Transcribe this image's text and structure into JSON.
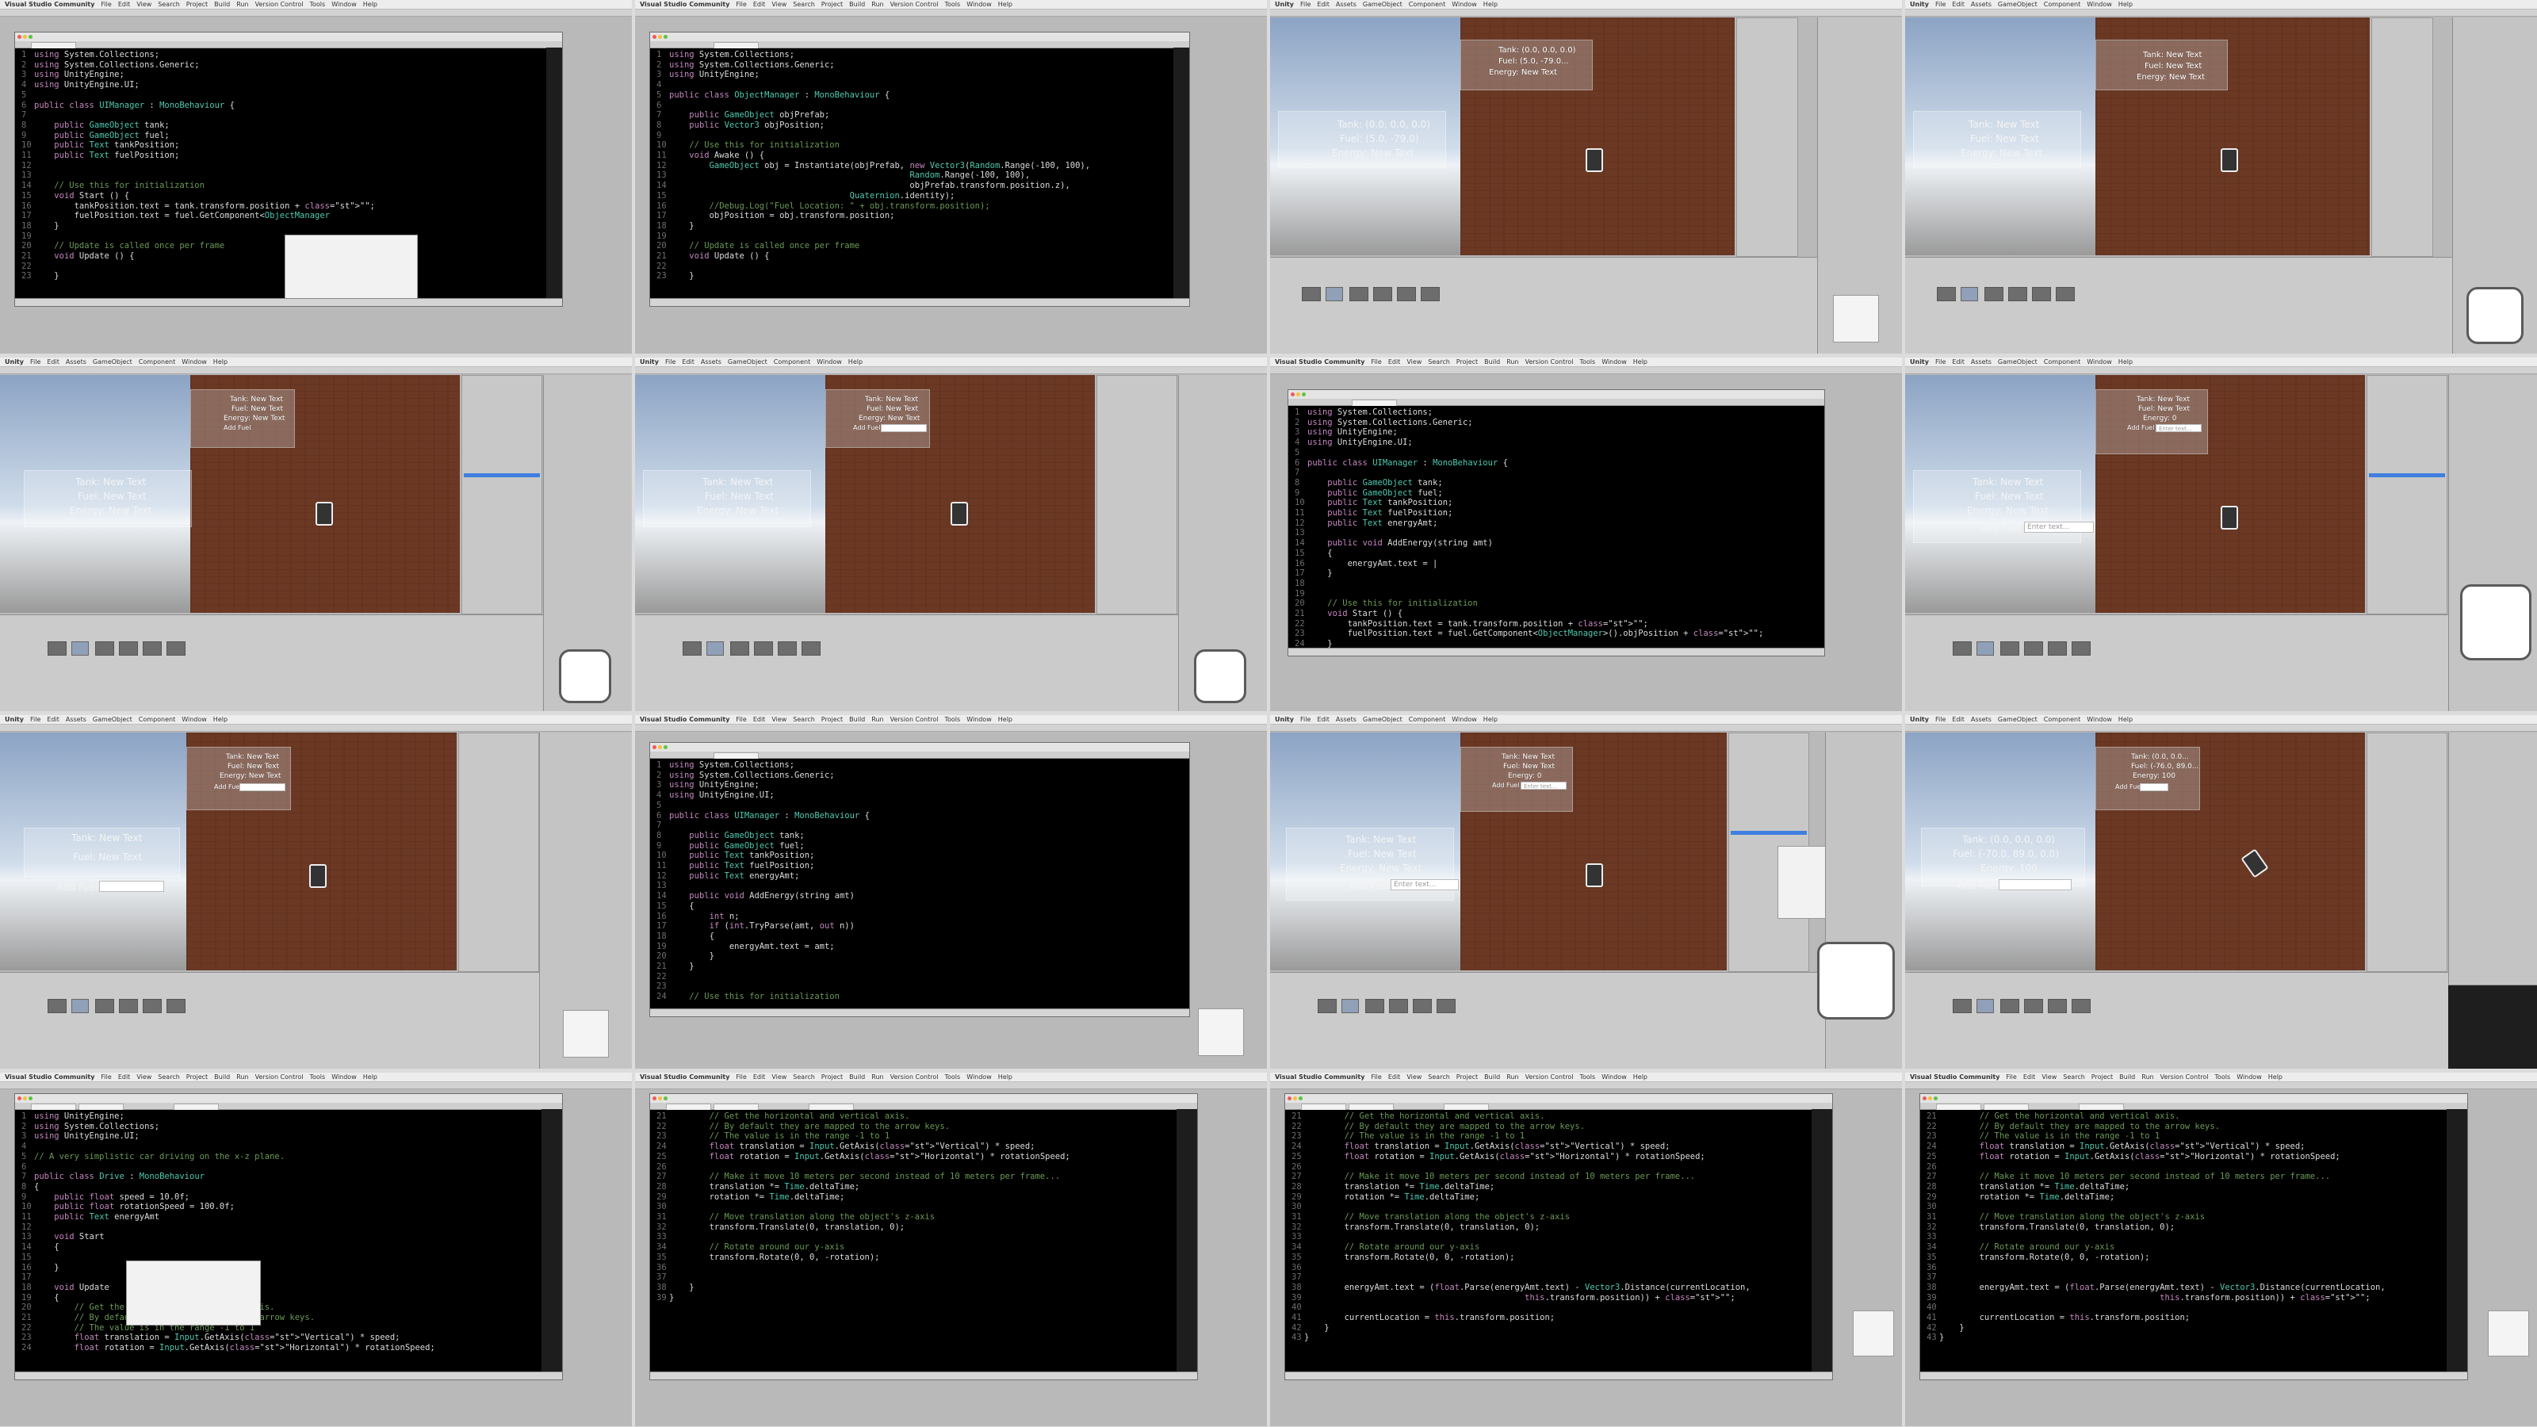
{
  "menus": {
    "vs": {
      "app": "Visual Studio Community",
      "items": [
        "File",
        "Edit",
        "View",
        "Search",
        "Project",
        "Build",
        "Run",
        "Version Control",
        "Tools",
        "Window",
        "Help"
      ]
    },
    "unity": {
      "app": "Unity",
      "items": [
        "File",
        "Edit",
        "Assets",
        "GameObject",
        "Component",
        "Window",
        "Help"
      ]
    }
  },
  "tiles": {
    "t1": {
      "lines": [
        [
          "1",
          "using System.Collections;"
        ],
        [
          "2",
          "using System.Collections.Generic;"
        ],
        [
          "3",
          "using UnityEngine;"
        ],
        [
          "4",
          "using UnityEngine.UI;"
        ],
        [
          "5",
          ""
        ],
        [
          "6",
          "public class UIManager : MonoBehaviour {"
        ],
        [
          "7",
          ""
        ],
        [
          "8",
          "    public GameObject tank;"
        ],
        [
          "9",
          "    public GameObject fuel;"
        ],
        [
          "10",
          "    public Text tankPosition;"
        ],
        [
          "11",
          "    public Text fuelPosition;"
        ],
        [
          "12",
          ""
        ],
        [
          "13",
          ""
        ],
        [
          "14",
          "    // Use this for initialization"
        ],
        [
          "15",
          "    void Start () {"
        ],
        [
          "16",
          "        tankPosition.text = tank.transform.position + \"\";"
        ],
        [
          "17",
          "        fuelPosition.text = fuel.GetComponent<ObjectManager"
        ],
        [
          "18",
          "    }"
        ],
        [
          "19",
          ""
        ],
        [
          "20",
          "    // Update is called once per frame"
        ],
        [
          "21",
          "    void Update () {"
        ],
        [
          "22",
          ""
        ],
        [
          "23",
          "    }"
        ]
      ]
    },
    "t2": {
      "lines": [
        [
          "1",
          "using System.Collections;"
        ],
        [
          "2",
          "using System.Collections.Generic;"
        ],
        [
          "3",
          "using UnityEngine;"
        ],
        [
          "4",
          ""
        ],
        [
          "5",
          "public class ObjectManager : MonoBehaviour {"
        ],
        [
          "6",
          ""
        ],
        [
          "7",
          "    public GameObject objPrefab;"
        ],
        [
          "8",
          "    public Vector3 objPosition;"
        ],
        [
          "9",
          ""
        ],
        [
          "10",
          "    // Use this for initialization"
        ],
        [
          "11",
          "    void Awake () {"
        ],
        [
          "12",
          "        GameObject obj = Instantiate(objPrefab, new Vector3(Random.Range(-100, 100),"
        ],
        [
          "13",
          "                                                Random.Range(-100, 100),"
        ],
        [
          "14",
          "                                                objPrefab.transform.position.z),"
        ],
        [
          "15",
          "                                    Quaternion.identity);"
        ],
        [
          "16",
          "        //Debug.Log(\"Fuel Location: \" + obj.transform.position);"
        ],
        [
          "17",
          "        objPosition = obj.transform.position;"
        ],
        [
          "18",
          "    }"
        ],
        [
          "19",
          ""
        ],
        [
          "20",
          "    // Update is called once per frame"
        ],
        [
          "21",
          "    void Update () {"
        ],
        [
          "22",
          ""
        ],
        [
          "23",
          "    }"
        ]
      ]
    },
    "t3": {
      "tank": "Tank: (0.0, 0.0, 0.0)",
      "fuel": "Fuel: (5.0, -79.0...",
      "energy": "Energy: New Text",
      "tank_l": "Tank: (0.0, 0.0, 0.0)",
      "fuel_l": "Fuel: (5.0, -79.0)",
      "energy_l": "Energy: New Text"
    },
    "t4": {
      "tank": "Tank: New Text",
      "fuel": "Fuel: New Text",
      "energy": "Energy: New Text",
      "tank_l": "Tank: New Text",
      "fuel_l": "Fuel: New Text",
      "energy_l": "Energy: New Text"
    },
    "t5": {
      "tank": "Tank: New Text",
      "fuel": "Fuel: New Text",
      "energy": "Energy: New Text",
      "add": "Add Fuel",
      "tank_l": "Tank: New Text",
      "fuel_l": "Fuel: New Text",
      "energy_l": "Energy: New Text"
    },
    "t6": {
      "tank": "Tank: New Text",
      "fuel": "Fuel: New Text",
      "energy": "Energy: New Text",
      "add": "Add Fuel",
      "tank_l": "Tank: New Text",
      "fuel_l": "Fuel: New Text",
      "energy_l": "Energy: New Text"
    },
    "t7": {
      "lines": [
        [
          "1",
          "using System.Collections;"
        ],
        [
          "2",
          "using System.Collections.Generic;"
        ],
        [
          "3",
          "using UnityEngine;"
        ],
        [
          "4",
          "using UnityEngine.UI;"
        ],
        [
          "5",
          ""
        ],
        [
          "6",
          "public class UIManager : MonoBehaviour {"
        ],
        [
          "7",
          ""
        ],
        [
          "8",
          "    public GameObject tank;"
        ],
        [
          "9",
          "    public GameObject fuel;"
        ],
        [
          "10",
          "    public Text tankPosition;"
        ],
        [
          "11",
          "    public Text fuelPosition;"
        ],
        [
          "12",
          "    public Text energyAmt;"
        ],
        [
          "13",
          ""
        ],
        [
          "14",
          "    public void AddEnergy(string amt)"
        ],
        [
          "15",
          "    {"
        ],
        [
          "16",
          "        energyAmt.text = |"
        ],
        [
          "17",
          "    }"
        ],
        [
          "18",
          ""
        ],
        [
          "19",
          ""
        ],
        [
          "20",
          "    // Use this for initialization"
        ],
        [
          "21",
          "    void Start () {"
        ],
        [
          "22",
          "        tankPosition.text = tank.transform.position + \"\";"
        ],
        [
          "23",
          "        fuelPosition.text = fuel.GetComponent<ObjectManager>().objPosition + \"\";"
        ],
        [
          "24",
          "    }"
        ]
      ]
    },
    "t8": {
      "tank": "Tank: New Text",
      "fuel": "Fuel: New Text",
      "energy": "Energy: 0",
      "add": "Add Fuel",
      "placeholder": "Enter text...",
      "tank_l": "Tank: New Text",
      "fuel_l": "Fuel: New Text",
      "energy_l": "Energy: New Text",
      "add_l": "Add Fuel",
      "placeholder_l": "Enter text..."
    },
    "t9": {
      "tank": "Tank: New Text",
      "fuel": "Fuel: New Text",
      "energy": "Energy: New Text",
      "add": "Add Fuel",
      "tank_l": "Tank: New Text",
      "fuel_l": "Fuel: New Text",
      "add_l": "Add Fuel"
    },
    "t10": {
      "lines": [
        [
          "1",
          "using System.Collections;"
        ],
        [
          "2",
          "using System.Collections.Generic;"
        ],
        [
          "3",
          "using UnityEngine;"
        ],
        [
          "4",
          "using UnityEngine.UI;"
        ],
        [
          "5",
          ""
        ],
        [
          "6",
          "public class UIManager : MonoBehaviour {"
        ],
        [
          "7",
          ""
        ],
        [
          "8",
          "    public GameObject tank;"
        ],
        [
          "9",
          "    public GameObject fuel;"
        ],
        [
          "10",
          "    public Text tankPosition;"
        ],
        [
          "11",
          "    public Text fuelPosition;"
        ],
        [
          "12",
          "    public Text energyAmt;"
        ],
        [
          "13",
          ""
        ],
        [
          "14",
          "    public void AddEnergy(string amt)"
        ],
        [
          "15",
          "    {"
        ],
        [
          "16",
          "        int n;"
        ],
        [
          "17",
          "        if (int.TryParse(amt, out n))"
        ],
        [
          "18",
          "        {"
        ],
        [
          "19",
          "            energyAmt.text = amt;"
        ],
        [
          "20",
          "        }"
        ],
        [
          "21",
          "    }"
        ],
        [
          "22",
          ""
        ],
        [
          "23",
          ""
        ],
        [
          "24",
          "    // Use this for initialization"
        ]
      ]
    },
    "t11": {
      "tank": "Tank: New Text",
      "fuel": "Fuel: New Text",
      "energy": "Energy: 0",
      "add": "Add Fuel",
      "placeholder": "Enter text...",
      "tank_l": "Tank: New Text",
      "fuel_l": "Fuel: New Text",
      "energy_l": "Energy: New Text",
      "add_l": "Add Fuel",
      "placeholder_l": "Enter text..."
    },
    "t12": {
      "tank": "Tank: (0.0, 0.0...",
      "fuel": "Fuel: (-76.0, 89.0...",
      "energy": "Energy: 100",
      "add": "Add Fuel",
      "tank_l": "Tank: (0.0, 0.0, 0.0)",
      "fuel_l": "Fuel: (-70.0, 89.0, 0.0)",
      "energy_l": "Energy: 100",
      "add_l": "Add Fuel"
    },
    "t13": {
      "lines": [
        [
          "1",
          "using UnityEngine;"
        ],
        [
          "2",
          "using System.Collections;"
        ],
        [
          "3",
          "using UnityEngine.UI;"
        ],
        [
          "4",
          ""
        ],
        [
          "5",
          "// A very simplistic car driving on the x-z plane."
        ],
        [
          "6",
          ""
        ],
        [
          "7",
          "public class Drive : MonoBehaviour"
        ],
        [
          "8",
          "{"
        ],
        [
          "9",
          "    public float speed = 10.0f;"
        ],
        [
          "10",
          "    public float rotationSpeed = 100.0f;"
        ],
        [
          "11",
          "    public Text energyAmt"
        ],
        [
          "12",
          ""
        ],
        [
          "13",
          "    void Start"
        ],
        [
          "14",
          "    {"
        ],
        [
          "15",
          ""
        ],
        [
          "16",
          "    }"
        ],
        [
          "17",
          ""
        ],
        [
          "18",
          "    void Update"
        ],
        [
          "19",
          "    {"
        ],
        [
          "20",
          "        // Get the horizontal and vertical axis."
        ],
        [
          "21",
          "        // By default they are mapped to the arrow keys."
        ],
        [
          "22",
          "        // The value is in the range -1 to 1"
        ],
        [
          "23",
          "        float translation = Input.GetAxis(\"Vertical\") * speed;"
        ],
        [
          "24",
          "        float rotation = Input.GetAxis(\"Horizontal\") * rotationSpeed;"
        ]
      ]
    },
    "t14": {
      "lines": [
        [
          "21",
          "        // Get the horizontal and vertical axis."
        ],
        [
          "22",
          "        // By default they are mapped to the arrow keys."
        ],
        [
          "23",
          "        // The value is in the range -1 to 1"
        ],
        [
          "24",
          "        float translation = Input.GetAxis(\"Vertical\") * speed;"
        ],
        [
          "25",
          "        float rotation = Input.GetAxis(\"Horizontal\") * rotationSpeed;"
        ],
        [
          "26",
          ""
        ],
        [
          "27",
          "        // Make it move 10 meters per second instead of 10 meters per frame..."
        ],
        [
          "28",
          "        translation *= Time.deltaTime;"
        ],
        [
          "29",
          "        rotation *= Time.deltaTime;"
        ],
        [
          "30",
          ""
        ],
        [
          "31",
          "        // Move translation along the object's z-axis"
        ],
        [
          "32",
          "        transform.Translate(0, translation, 0);"
        ],
        [
          "33",
          ""
        ],
        [
          "34",
          "        // Rotate around our y-axis"
        ],
        [
          "35",
          "        transform.Rotate(0, 0, -rotation);"
        ],
        [
          "36",
          ""
        ],
        [
          "37",
          ""
        ],
        [
          "38",
          "    }"
        ],
        [
          "39",
          "}"
        ]
      ]
    },
    "t15": {
      "lines": [
        [
          "21",
          "        // Get the horizontal and vertical axis."
        ],
        [
          "22",
          "        // By default they are mapped to the arrow keys."
        ],
        [
          "23",
          "        // The value is in the range -1 to 1"
        ],
        [
          "24",
          "        float translation = Input.GetAxis(\"Vertical\") * speed;"
        ],
        [
          "25",
          "        float rotation = Input.GetAxis(\"Horizontal\") * rotationSpeed;"
        ],
        [
          "26",
          ""
        ],
        [
          "27",
          "        // Make it move 10 meters per second instead of 10 meters per frame..."
        ],
        [
          "28",
          "        translation *= Time.deltaTime;"
        ],
        [
          "29",
          "        rotation *= Time.deltaTime;"
        ],
        [
          "30",
          ""
        ],
        [
          "31",
          "        // Move translation along the object's z-axis"
        ],
        [
          "32",
          "        transform.Translate(0, translation, 0);"
        ],
        [
          "33",
          ""
        ],
        [
          "34",
          "        // Rotate around our y-axis"
        ],
        [
          "35",
          "        transform.Rotate(0, 0, -rotation);"
        ],
        [
          "36",
          ""
        ],
        [
          "37",
          ""
        ],
        [
          "38",
          "        energyAmt.text = (float.Parse(energyAmt.text) - Vector3.Distance(currentLocation,"
        ],
        [
          "39",
          "                                            this.transform.position)) + \"\";"
        ],
        [
          "40",
          ""
        ],
        [
          "41",
          "        currentLocation = this.transform.position;"
        ],
        [
          "42",
          "    }"
        ],
        [
          "43",
          "}"
        ]
      ]
    },
    "t16": {
      "lines": [
        [
          "21",
          "        // Get the horizontal and vertical axis."
        ],
        [
          "22",
          "        // By default they are mapped to the arrow keys."
        ],
        [
          "23",
          "        // The value is in the range -1 to 1"
        ],
        [
          "24",
          "        float translation = Input.GetAxis(\"Vertical\") * speed;"
        ],
        [
          "25",
          "        float rotation = Input.GetAxis(\"Horizontal\") * rotationSpeed;"
        ],
        [
          "26",
          ""
        ],
        [
          "27",
          "        // Make it move 10 meters per second instead of 10 meters per frame..."
        ],
        [
          "28",
          "        translation *= Time.deltaTime;"
        ],
        [
          "29",
          "        rotation *= Time.deltaTime;"
        ],
        [
          "30",
          ""
        ],
        [
          "31",
          "        // Move translation along the object's z-axis"
        ],
        [
          "32",
          "        transform.Translate(0, translation, 0);"
        ],
        [
          "33",
          ""
        ],
        [
          "34",
          "        // Rotate around our y-axis"
        ],
        [
          "35",
          "        transform.Rotate(0, 0, -rotation);"
        ],
        [
          "36",
          ""
        ],
        [
          "37",
          ""
        ],
        [
          "38",
          "        energyAmt.text = (float.Parse(energyAmt.text) - Vector3.Distance(currentLocation,"
        ],
        [
          "39",
          "                                            this.transform.position)) + \"\";"
        ],
        [
          "40",
          ""
        ],
        [
          "41",
          "        currentLocation = this.transform.position;"
        ],
        [
          "42",
          "    }"
        ],
        [
          "43",
          "}"
        ]
      ]
    }
  }
}
